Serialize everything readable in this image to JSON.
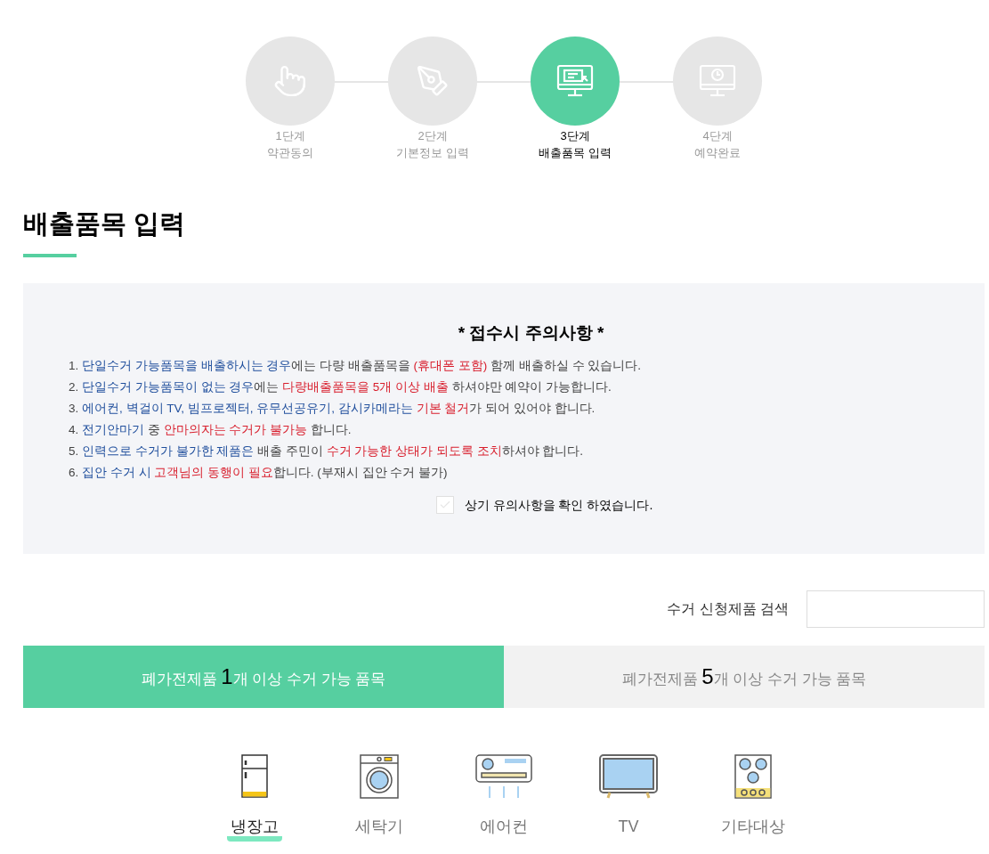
{
  "steps": [
    {
      "kind": "tap",
      "number": "1단계",
      "label": "약관동의",
      "selected": false
    },
    {
      "kind": "pen",
      "number": "2단계",
      "label": "기본정보 입력",
      "selected": false
    },
    {
      "kind": "form",
      "number": "3단계",
      "label": "배출품목 입력",
      "selected": true
    },
    {
      "kind": "clock",
      "number": "4단계",
      "label": "예약완료",
      "selected": false
    }
  ],
  "page_title": "배출품목 입력",
  "notice": {
    "title": "*  접수시 주의사항  *",
    "items": [
      [
        {
          "color": "#444444",
          "text": "1. "
        },
        {
          "color": "#1f4e9c",
          "text": "단일수거 가능품목을 배출하시는 경우"
        },
        {
          "color": "#444444",
          "text": "에는 다량 배출품목을 "
        },
        {
          "color": "#d81e2c",
          "text": "(휴대폰 포함)"
        },
        {
          "color": "#444444",
          "text": " 함께 배출하실 수 있습니다."
        }
      ],
      [
        {
          "color": "#444444",
          "text": "2. "
        },
        {
          "color": "#1f4e9c",
          "text": "단일수거 가능품목이 없는 경우"
        },
        {
          "color": "#444444",
          "text": "에는 "
        },
        {
          "color": "#d81e2c",
          "text": "다량배출품목을 5개 이상 배출"
        },
        {
          "color": "#444444",
          "text": " 하셔야만 예약이 가능합니다."
        }
      ],
      [
        {
          "color": "#444444",
          "text": "3. "
        },
        {
          "color": "#1f4e9c",
          "text": "에어컨, 벽걸이 TV, 빔프로젝터, 유무선공유기, 감시카메라는"
        },
        {
          "color": "#d81e2c",
          "text": " 기본 철거"
        },
        {
          "color": "#444444",
          "text": "가 되어 있어야 합니다."
        }
      ],
      [
        {
          "color": "#444444",
          "text": "4. "
        },
        {
          "color": "#1f4e9c",
          "text": "전기안마기"
        },
        {
          "color": "#444444",
          "text": " 중 "
        },
        {
          "color": "#d81e2c",
          "text": "안마의자는 수거가 불가능"
        },
        {
          "color": "#444444",
          "text": " 합니다."
        }
      ],
      [
        {
          "color": "#444444",
          "text": "5. "
        },
        {
          "color": "#1f4e9c",
          "text": "인력으로 수거가 불가한 제품은"
        },
        {
          "color": "#444444",
          "text": " 배출 주민이 "
        },
        {
          "color": "#d81e2c",
          "text": "수거 가능한 상태가 되도록 조치"
        },
        {
          "color": "#444444",
          "text": "하셔야 합니다."
        }
      ],
      [
        {
          "color": "#444444",
          "text": "6. "
        },
        {
          "color": "#1f4e9c",
          "text": "집안 수거 시"
        },
        {
          "color": "#d81e2c",
          "text": " 고객님의 동행이 필요"
        },
        {
          "color": "#444444",
          "text": "합니다. (부재시 집안 수거 불가)"
        }
      ]
    ],
    "confirm": {
      "label": "상기 유의사항을 확인 하였습니다.",
      "checked": false
    }
  },
  "search": {
    "label": "수거 신청제품 검색"
  },
  "tabs": [
    {
      "prefix": "폐가전제품 ",
      "count": "1",
      "suffix": "개 이상 수거 가능 품목",
      "selected": true
    },
    {
      "prefix": "폐가전제품 ",
      "count": "5",
      "suffix": "개 이상 수거 가능 품목",
      "selected": false
    }
  ],
  "categories": [
    {
      "kind": "fridge",
      "label": "냉장고",
      "selected": true
    },
    {
      "kind": "washer",
      "label": "세탁기",
      "selected": false
    },
    {
      "kind": "aircon",
      "label": "에어컨",
      "selected": false
    },
    {
      "kind": "tv",
      "label": "TV",
      "selected": false
    },
    {
      "kind": "stove",
      "label": "기타대상",
      "selected": false
    }
  ]
}
